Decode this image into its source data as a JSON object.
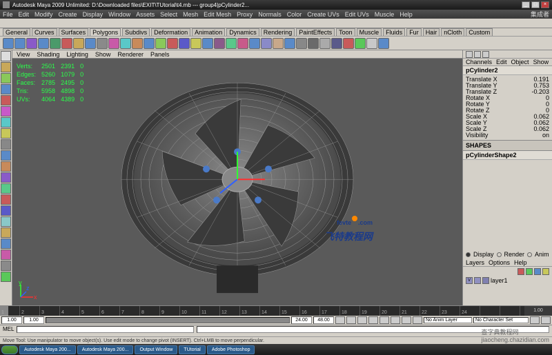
{
  "titlebar": {
    "title": "Autodesk Maya 2009 Unlimited: D:\\Downloaded files\\EXIT\\TUtorial\\t4.mb --- group4|pCylinder2..."
  },
  "menubar": [
    "File",
    "Edit",
    "Modify",
    "Create",
    "Display",
    "Window",
    "Assets",
    "Select",
    "Mesh",
    "Edit Mesh",
    "Proxy",
    "Normals",
    "Color",
    "Create UVs",
    "Edit UVs",
    "Muscle",
    "Help"
  ],
  "menubar_right": "集成者",
  "module_tabs": [
    "General",
    "Curves",
    "Surfaces",
    "Polygons",
    "Subdivs",
    "Deformation",
    "Animation",
    "Dynamics",
    "Rendering",
    "PaintEffects",
    "Toon",
    "Muscle",
    "Fluids",
    "Fur",
    "Hair",
    "nCloth",
    "Custom"
  ],
  "module_active": "Polygons",
  "panel_menu": [
    "View",
    "Shading",
    "Lighting",
    "Show",
    "Renderer",
    "Panels"
  ],
  "stats": {
    "rows": [
      [
        "Verts:",
        "2501",
        "2391",
        "0"
      ],
      [
        "Edges:",
        "5260",
        "1079",
        "0"
      ],
      [
        "Faces:",
        "2785",
        "2495",
        "0"
      ],
      [
        "Tris:",
        "5958",
        "4898",
        "0"
      ],
      [
        "UVs:",
        "4064",
        "4389",
        "0"
      ]
    ]
  },
  "channel_box": {
    "tabs": [
      "Channels",
      "Edit",
      "Object",
      "Show"
    ],
    "object": "pCylinder2",
    "attrs": [
      {
        "label": "Translate X",
        "value": "0.191"
      },
      {
        "label": "Translate Y",
        "value": "0.753"
      },
      {
        "label": "Translate Z",
        "value": "-0.203"
      },
      {
        "label": "Rotate X",
        "value": "0"
      },
      {
        "label": "Rotate Y",
        "value": "0"
      },
      {
        "label": "Rotate Z",
        "value": "0"
      },
      {
        "label": "Scale X",
        "value": "0.062"
      },
      {
        "label": "Scale Y",
        "value": "0.062"
      },
      {
        "label": "Scale Z",
        "value": "0.062"
      },
      {
        "label": "Visibility",
        "value": "on"
      }
    ],
    "shapes_header": "SHAPES",
    "shape_name": "pCylinderShape2",
    "display_options": [
      "Display",
      "Render",
      "Anim"
    ],
    "layer_tabs": [
      "Layers",
      "Options",
      "Help"
    ],
    "layer_name": "layer1",
    "layer_vis": "V"
  },
  "timeline": {
    "start": "1.00",
    "end": "24.00",
    "range_start": "1.00",
    "range_end": "48.00",
    "anim_layer": "No Anim Layer",
    "char_set": "No Character Set"
  },
  "cmd": {
    "label": "MEL"
  },
  "helpline": "Move Tool: Use manipulator to move object(s). Use edit mode to change pivot (INSERT). Ctrl+LMB to move perpendicular.",
  "taskbar": [
    "Autodesk Maya 200...",
    "Autodesk Maya 200...",
    "Output Window",
    "TUtorial",
    "Adobe Photoshop"
  ],
  "watermark": {
    "main_a": "fevte",
    "main_b": ".com",
    "sub": "飞特教程网",
    "footer1": "查字典教程网",
    "footer2": "jiaocheng.chazidian.com"
  },
  "shelf_colors": [
    "#5a8ac8",
    "#5a8ac8",
    "#8a5ac8",
    "#5a8ac8",
    "#4a9a6a",
    "#c85a5a",
    "#c8a85a",
    "#5a8ac8",
    "#8a8a8a",
    "#c85aa8",
    "#5ac8c8",
    "#c88a5a",
    "#5a8ac8",
    "#8ac85a",
    "#c85a5a",
    "#5a5ac8",
    "#c8c85a",
    "#5a8ac8",
    "#8a5a8a",
    "#5ac88a",
    "#c85a8a",
    "#5a8ac8",
    "#8a8ac8",
    "#c8a88a",
    "#5a8ac8",
    "#888",
    "#6a6a6a",
    "#aaa",
    "#5a5a8a",
    "#c85a5a",
    "#5ac85a",
    "#c8c8c8",
    "#5a8ac8"
  ],
  "tool_colors": [
    "#ddd",
    "#c8a85a",
    "#8ac85a",
    "#5a8ac8",
    "#c85a5a",
    "#c85ac8",
    "#5ac8c8",
    "#c8c85a",
    "#888",
    "#5a8ac8",
    "#c88a5a",
    "#8a5ac8",
    "#5ac88a",
    "#c85a5a",
    "#5a5ac8",
    "#8ac8c8",
    "#c8a85a",
    "#5a8ac8",
    "#c85aa8",
    "#8a8a8a",
    "#5ac85a"
  ]
}
